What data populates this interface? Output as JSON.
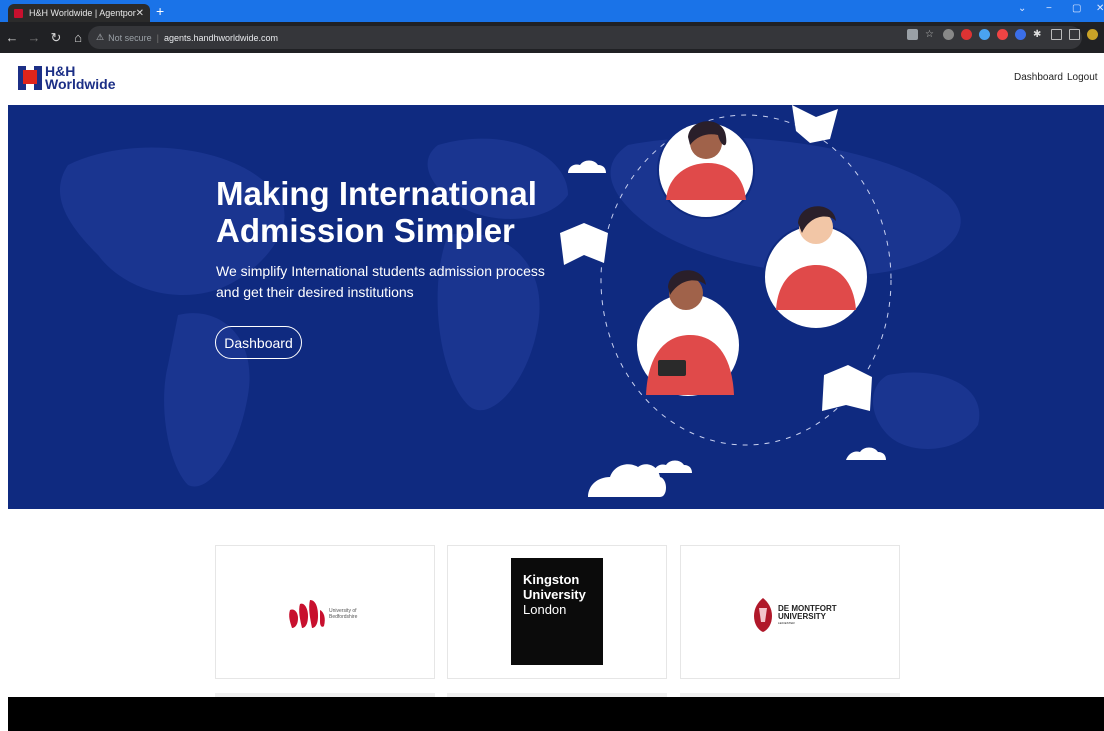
{
  "browser": {
    "tab_title": "H&H Worldwide | Agentportal",
    "tab_close": "✕",
    "new_tab": "+",
    "security_label": "Not secure",
    "url": "agents.handhworldwide.com"
  },
  "site": {
    "logo_line1": "H&H",
    "logo_line2": "Worldwide",
    "nav": {
      "dashboard": "Dashboard",
      "logout": "Logout"
    }
  },
  "hero": {
    "title_line1": "Making International",
    "title_line2": "Admission Simpler",
    "subtitle": "We simplify International students admission process and get their desired institutions",
    "button": "Dashboard",
    "background_color": "#0f2a80"
  },
  "universities": [
    {
      "name_line1": "University of",
      "name_line2": "Bedfordshire"
    },
    {
      "name_line1": "Kingston",
      "name_line2": "University",
      "name_line3": "London"
    },
    {
      "name_line1": "DE MONTFORT",
      "name_line2": "UNIVERSITY",
      "name_line3": "LEICESTER"
    }
  ],
  "colors": {
    "brand_blue": "#1c2f86",
    "brand_red": "#e1251b",
    "accent_red": "#e04a4a"
  }
}
